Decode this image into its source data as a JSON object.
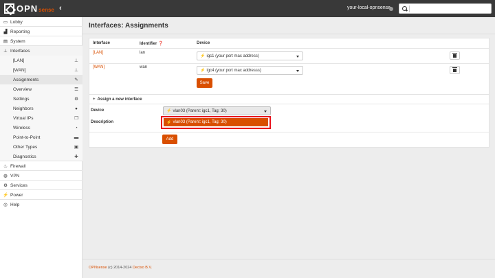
{
  "topbar": {
    "logo_text": "OPN",
    "logo_sense": "sense",
    "hostname": "your-local-opnsense",
    "search_placeholder": ""
  },
  "sidebar": {
    "items": [
      {
        "label": "Lobby",
        "icon": "laptop-icon"
      },
      {
        "label": "Reporting",
        "icon": "chart-icon"
      },
      {
        "label": "System",
        "icon": "server-icon"
      },
      {
        "label": "Interfaces",
        "icon": "sitemap-icon"
      },
      {
        "label": "[LAN]",
        "icon": "sitemap-icon"
      },
      {
        "label": "[WAN]",
        "icon": "sitemap-icon"
      },
      {
        "label": "Assignments",
        "icon": "pencil-icon"
      },
      {
        "label": "Overview",
        "icon": "list-icon"
      },
      {
        "label": "Settings",
        "icon": "cogs-icon"
      },
      {
        "label": "Neighbors",
        "icon": "users-icon"
      },
      {
        "label": "Virtual IPs",
        "icon": "copy-icon"
      },
      {
        "label": "Wireless",
        "icon": "wifi-icon"
      },
      {
        "label": "Point-to-Point",
        "icon": "drive-icon"
      },
      {
        "label": "Other Types",
        "icon": "archive-icon"
      },
      {
        "label": "Diagnostics",
        "icon": "medkit-icon"
      },
      {
        "label": "Firewall",
        "icon": "fire-icon"
      },
      {
        "label": "VPN",
        "icon": "globe-icon"
      },
      {
        "label": "Services",
        "icon": "cog-icon"
      },
      {
        "label": "Power",
        "icon": "plug-icon"
      },
      {
        "label": "Help",
        "icon": "lifebuoy-icon"
      }
    ]
  },
  "main": {
    "title": "Interfaces: Assignments",
    "table": {
      "headers": [
        "Interface",
        "Identifier",
        "Device"
      ],
      "rows": [
        {
          "interface": "[LAN]",
          "identifier": "lan",
          "device": "igc1 (your port mac address)"
        },
        {
          "interface": "[WAN]",
          "identifier": "wan",
          "device": "igc4 (your port mac addresss)"
        }
      ],
      "save_label": "Save"
    },
    "assign": {
      "heading": "Assign a new interface",
      "device_label": "Device",
      "description_label": "Description",
      "device_value": "vlan03 (Parent: igc1, Tag: 30)",
      "dropdown_option": "vlan03 (Parent: igc1, Tag: 30)",
      "add_label": "Add"
    }
  },
  "footer": {
    "brand": "OPNsense",
    "copyright": "(c) 2014-2024",
    "company": "Deciso B.V."
  },
  "colors": {
    "accent": "#d94f00",
    "topbar": "#393939",
    "highlight": "#e8101c"
  }
}
